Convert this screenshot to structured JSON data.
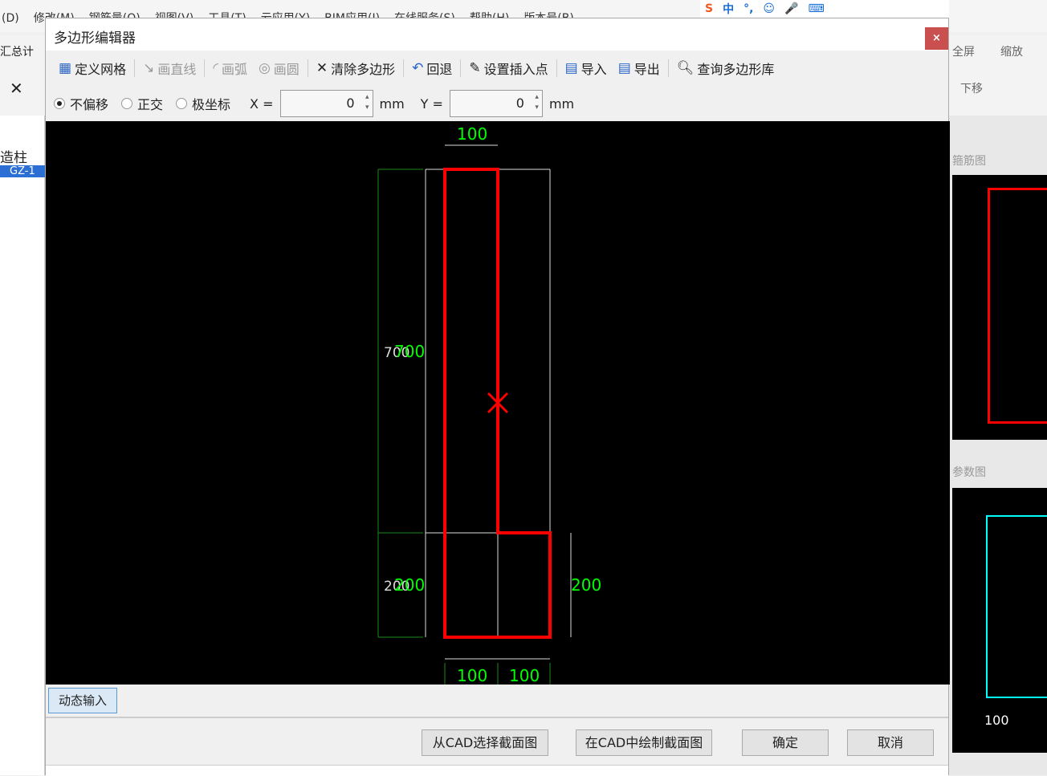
{
  "background": {
    "menu": [
      "(D)",
      "修改(M)",
      "钢筋量(Q)",
      "视图(V)",
      "工具(T)",
      "云应用(Y)",
      "BIM应用(I)",
      "在线服务(S)",
      "帮助(H)",
      "版本号(B)"
    ],
    "left_items": [
      "汇总计",
      "删",
      "造柱",
      "GZ-1"
    ],
    "right_items": [
      "全屏",
      "缩放",
      "下移",
      "箍筋图",
      "参数图",
      "100"
    ],
    "ime_label": "中"
  },
  "dialog": {
    "title": "多边形编辑器",
    "close_label": "×",
    "toolbar": [
      {
        "label": "定义网格",
        "icon": "grid-icon",
        "enabled": true
      },
      {
        "label": "画直线",
        "icon": "line-icon",
        "enabled": false
      },
      {
        "label": "画弧",
        "icon": "arc-icon",
        "enabled": false
      },
      {
        "label": "画圆",
        "icon": "circle-icon",
        "enabled": false
      },
      {
        "label": "清除多边形",
        "icon": "clear-icon",
        "enabled": true
      },
      {
        "label": "回退",
        "icon": "undo-icon",
        "enabled": true
      },
      {
        "label": "设置插入点",
        "icon": "insert-point-icon",
        "enabled": true
      },
      {
        "label": "导入",
        "icon": "import-icon",
        "enabled": true
      },
      {
        "label": "导出",
        "icon": "export-icon",
        "enabled": true
      },
      {
        "label": "查询多边形库",
        "icon": "search-icon",
        "enabled": true
      }
    ],
    "modes": [
      {
        "label": "不偏移",
        "selected": true
      },
      {
        "label": "正交",
        "selected": false
      },
      {
        "label": "极坐标",
        "selected": false
      }
    ],
    "x_label": "X =",
    "x_value": "0",
    "y_label": "Y =",
    "y_value": "0",
    "unit": "mm",
    "drawing": {
      "dims": {
        "top": "100",
        "left_upper": "700",
        "left_lower": "200",
        "right": "200",
        "bottom_left": "100",
        "bottom_right": "100"
      },
      "polygon_color": "#ff0000",
      "dim_color": "#00ff00"
    },
    "dynamic_input": "动态输入",
    "buttons": {
      "select_cad": "从CAD选择截面图",
      "draw_cad": "在CAD中绘制截面图",
      "ok": "确定",
      "cancel": "取消"
    }
  }
}
